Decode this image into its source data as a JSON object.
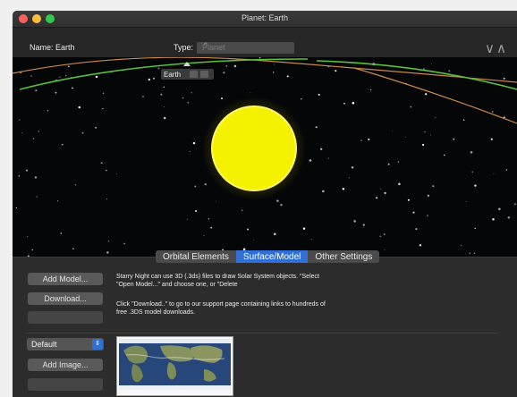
{
  "window": {
    "title": "Planet: Earth"
  },
  "toolbar": {
    "name_label": "Name:",
    "name_value": "Earth",
    "type_label": "Type:",
    "type_value": "Planet",
    "collapse_icon": "double-chevron-up-icon"
  },
  "sky": {
    "planet_label": "Earth"
  },
  "tabs": [
    {
      "label": "Orbital Elements",
      "active": false
    },
    {
      "label": "Surface/Model",
      "active": true
    },
    {
      "label": "Other Settings",
      "active": false
    }
  ],
  "model": {
    "add_model_label": "Add Model...",
    "download_label": "Download...",
    "help_text_1": "Starry Night can use 3D (.3ds) files to draw Solar System objects. \"Select \"Open Model...\" and choose one, or \"Delete",
    "help_text_2": "Click \"Download..\" to go to our support page containing links to hundreds of free .3DS model downloads."
  },
  "image": {
    "preset_value": "Default",
    "add_image_label": "Add Image..."
  },
  "colors": {
    "accent": "#2f6fd6",
    "sun": "#f4f200",
    "orbit_green": "#58c13b",
    "orbit_tan": "#c98a4a"
  }
}
